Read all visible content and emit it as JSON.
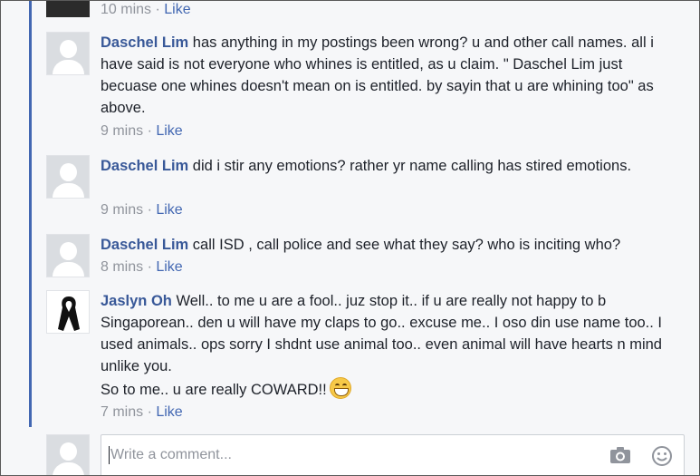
{
  "top": {
    "time": "10 mins",
    "like": "Like"
  },
  "comments": [
    {
      "author": "Daschel Lim",
      "text": " has anything in my postings been wrong? u and other call names. all i have said is not everyone who whines is entitled, as u claim. \" Daschel Lim just becuase one whines doesn't mean on is entitled. by sayin that u are whining too\" as above.",
      "time": "9 mins",
      "like": "Like"
    },
    {
      "author": "Daschel Lim",
      "text": " did i stir any emotions? rather yr name calling has stired emotions.",
      "time": "9 mins",
      "like": "Like"
    },
    {
      "author": "Daschel Lim",
      "text": " call ISD , call police and see what they say? who is inciting who?",
      "time": "8 mins",
      "like": "Like"
    },
    {
      "author": "Jaslyn Oh",
      "text": " Well.. to me u are a fool.. juz stop it.. if u are really not happy to b Singaporean.. den u will have my claps to go.. excuse me.. I oso din use name too.. I used animals.. ops sorry I shdnt use animal too.. even animal will have hearts n mind unlike you.",
      "text2": "So to me.. u are really COWARD!!",
      "time": "7 mins",
      "like": "Like"
    }
  ],
  "compose": {
    "placeholder": "Write a comment..."
  },
  "meta_separator": " · ",
  "colors": {
    "author": "#385898",
    "link": "#4267b2",
    "meta": "#90949c",
    "thread_bar": "#4267b2"
  }
}
